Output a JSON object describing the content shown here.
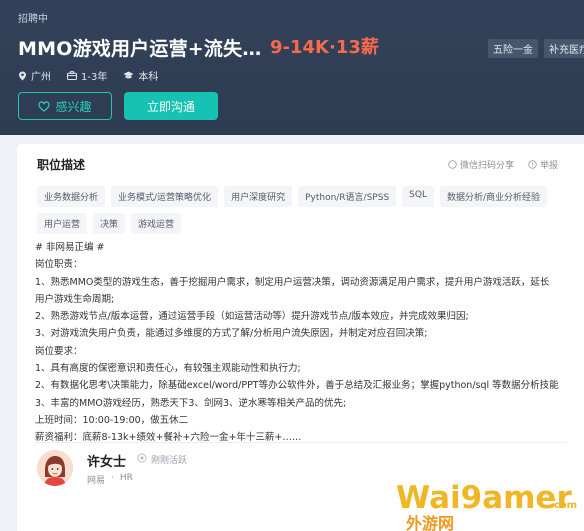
{
  "header": {
    "recruit_status": "招聘中",
    "job_title": "MMO游戏用户运营+流失…",
    "salary": "9-14K·13薪",
    "benefits": [
      "五险一金",
      "补充医疗保"
    ],
    "meta": {
      "location": "广州",
      "experience": "1-3年",
      "education": "本科"
    },
    "buttons": {
      "interest": "感兴趣",
      "chat": "立即沟通"
    }
  },
  "job_desc": {
    "title": "职位描述",
    "share_label": "微信扫码分享",
    "report_label": "举报",
    "tags": [
      "业务数据分析",
      "业务模式/运营策略优化",
      "用户深度研究",
      "Python/R语言/SPSS",
      "SQL",
      "数据分析/商业分析经验",
      "用户运营",
      "决策",
      "游戏运营"
    ],
    "lines": [
      "# 非网易正编 #",
      "岗位职责：",
      "1、熟悉MMO类型的游戏生态，善于挖掘用户需求，制定用户运营决策，调动资源满足用户需求，提升用户游戏活跃，延长",
      "用户游戏生命周期;",
      "2、熟悉游戏节点/版本运营，通过运营手段（如运营活动等）提升游戏节点/版本效应，并完成效果归因;",
      "3、对游戏流失用户负责，能通过多维度的方式了解/分析用户流失原因，并制定对应召回决策;",
      "岗位要求：",
      "1、具有高度的保密意识和责任心，有较强主观能动性和执行力;",
      "2、有数据化思考\\决策能力，除基础excel/word/PPT等办公软件外，善于总结及汇报业务；掌握python/sql 等数据分析技能",
      "3、丰富的MMO游戏经历，熟悉天下3、剑网3、逆水寒等相关产品的优先;",
      "上班时间：10:00-19:00，做五休二",
      "薪资福利：底薪8-13k+绩效+餐补+六险一金+年十三薪+……"
    ]
  },
  "recruiter": {
    "name": "许女士",
    "status": "刚刚活跃",
    "company": "网易",
    "separator": "·",
    "role": "HR"
  },
  "watermark": {
    "brand": "Wai9amer",
    "com": ".com",
    "subtitle": "外游网"
  },
  "colors": {
    "header_bg": "#2e3c52",
    "accent_teal": "#16c2b2",
    "salary_orange": "#fa6a4a",
    "watermark_gold": "#f1b625"
  }
}
